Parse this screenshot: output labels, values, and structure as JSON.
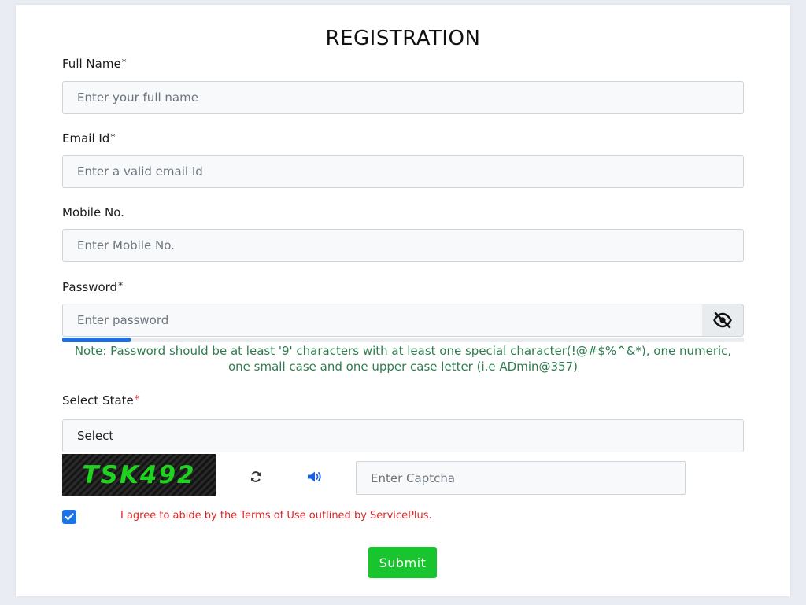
{
  "form": {
    "title": "REGISTRATION",
    "full_name": {
      "label": "Full Name",
      "required_mark": "*",
      "placeholder": "Enter your full name"
    },
    "email": {
      "label": "Email Id",
      "required_mark": "*",
      "placeholder": "Enter a valid email Id"
    },
    "mobile": {
      "label": "Mobile No.",
      "placeholder": "Enter Mobile No."
    },
    "password": {
      "label": "Password",
      "required_mark": "*",
      "placeholder": "Enter password",
      "toggle_icon": "eye-slash-icon",
      "strength_fraction": 0.1,
      "strength_color": "#1f6fe0",
      "note": "Note: Password should be at least '9' characters with at least one special character(!@#$%^&*), one numeric, one small case and one upper case letter (i.e ADmin@357)"
    },
    "state": {
      "label": "Select State",
      "required_mark": "*",
      "selected": "Select"
    },
    "captcha": {
      "code": "TSK492",
      "refresh_icon": "refresh-icon",
      "audio_icon": "speaker-icon",
      "placeholder": "Enter Captcha"
    },
    "terms": {
      "checked": true,
      "text": "I agree to abide by the Terms of Use outlined by ServicePlus."
    },
    "submit_label": "Submit"
  },
  "colors": {
    "accent_blue": "#1a73e8",
    "note_green": "#2e7d4f",
    "terms_red": "#e02424",
    "submit_green": "#19c52f",
    "captcha_green": "#1ed31e"
  }
}
